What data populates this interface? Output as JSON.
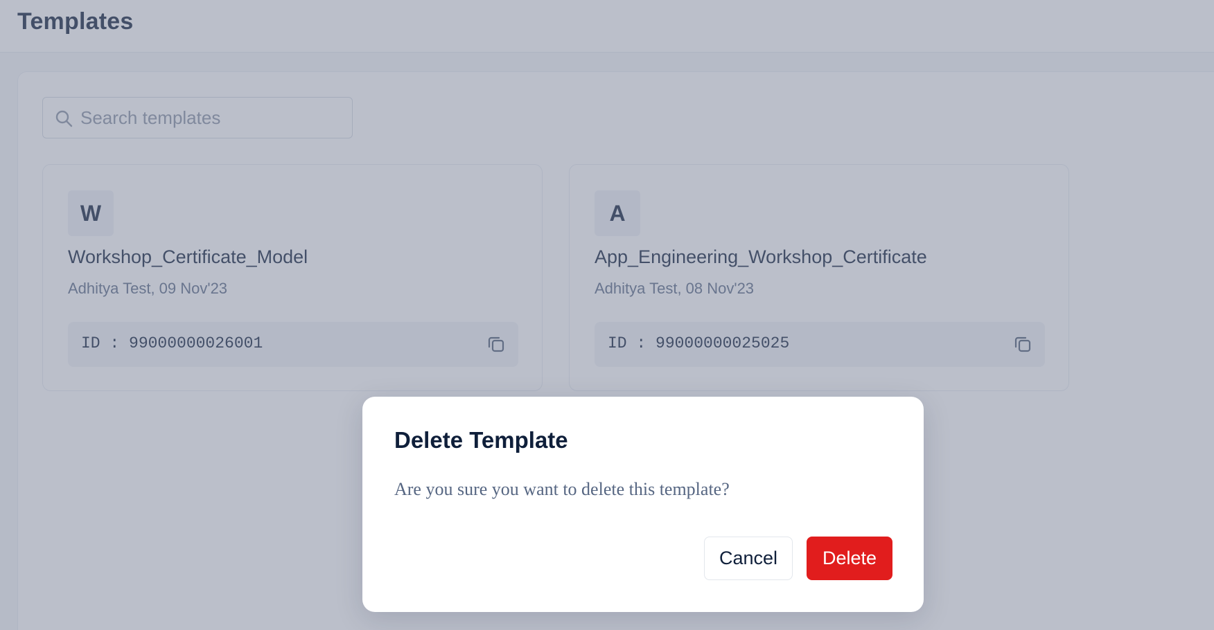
{
  "header": {
    "title": "Templates"
  },
  "search": {
    "placeholder": "Search templates",
    "value": ""
  },
  "templates": [
    {
      "initial": "W",
      "name": "Workshop_Certificate_Model",
      "meta": "Adhitya Test, 09 Nov'23",
      "id_text": "ID : 99000000026001"
    },
    {
      "initial": "A",
      "name": "App_Engineering_Workshop_Certificate",
      "meta": "Adhitya Test, 08 Nov'23",
      "id_text": "ID : 99000000025025"
    }
  ],
  "modal": {
    "title": "Delete Template",
    "message": "Are you sure you want to delete this template?",
    "cancel_label": "Cancel",
    "delete_label": "Delete"
  },
  "icons": {
    "search": "search-icon",
    "copy": "copy-icon"
  },
  "colors": {
    "text_primary": "#0f1f3a",
    "text_secondary": "#5a6b86",
    "delete_button": "#e11d1d",
    "overlay": "rgba(120,128,150,0.5)"
  }
}
